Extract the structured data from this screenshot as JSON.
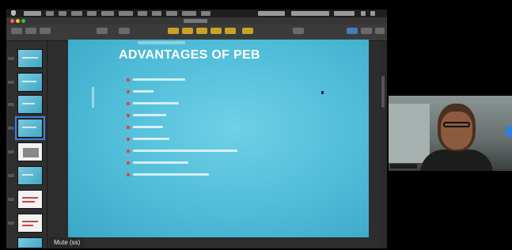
{
  "keynote": {
    "slide": {
      "title": "ADVANTAGES OF PEB"
    }
  },
  "meeting": {
    "mute_label": "Mute (ss)"
  },
  "colors": {
    "slide_teal": "#4fbcd8",
    "bullet_red": "#d94b4b",
    "selection_blue": "#3d7fe0",
    "toolbar_yellow": "#c9a227"
  },
  "icons": {
    "apple": "apple-icon",
    "traffic_lights": [
      "close-window-icon",
      "minimize-window-icon",
      "zoom-window-icon"
    ],
    "cursor": "mouse-pointer-icon",
    "video_tile_side": "camera-tab-icon"
  }
}
